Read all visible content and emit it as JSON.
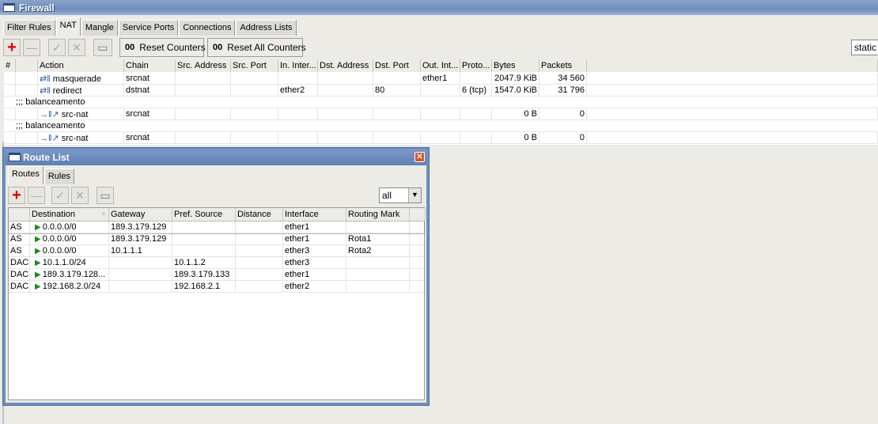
{
  "firewall": {
    "title": "Firewall",
    "tabs": [
      "Filter Rules",
      "NAT",
      "Mangle",
      "Service Ports",
      "Connections",
      "Address Lists"
    ],
    "active_tab": 1,
    "reset_counters": "Reset Counters",
    "reset_all_counters": "Reset All Counters",
    "counter_glyph": "00",
    "filter_value": "static",
    "columns": [
      "#",
      "",
      "Action",
      "Chain",
      "Src. Address",
      "Src. Port",
      "In. Inter...",
      "Dst. Address",
      "Dst. Port",
      "Out. Int...",
      "Proto...",
      "Bytes",
      "Packets"
    ],
    "rows": [
      {
        "type": "rule",
        "cells": [
          "",
          "",
          "masquerade",
          "srcnat",
          "",
          "",
          "",
          "",
          "",
          "ether1",
          "",
          "2047.9 KiB",
          "34 560"
        ]
      },
      {
        "type": "rule",
        "cells": [
          "",
          "",
          "redirect",
          "dstnat",
          "",
          "",
          "ether2",
          "",
          "80",
          "",
          "6 (tcp)",
          "1547.0 KiB",
          "31 796"
        ]
      },
      {
        "type": "comment",
        "text": ";;; balanceamento"
      },
      {
        "type": "rule",
        "cells": [
          "",
          "",
          "src-nat",
          "srcnat",
          "",
          "",
          "",
          "",
          "",
          "",
          "",
          "0 B",
          "0"
        ]
      },
      {
        "type": "comment",
        "text": ";;; balanceamento"
      },
      {
        "type": "rule",
        "cells": [
          "",
          "",
          "src-nat",
          "srcnat",
          "",
          "",
          "",
          "",
          "",
          "",
          "",
          "0 B",
          "0"
        ]
      }
    ]
  },
  "route_list": {
    "title": "Route List",
    "tabs": [
      "Routes",
      "Rules"
    ],
    "active_tab": 0,
    "filter_value": "all",
    "columns": [
      "",
      "Destination",
      "Gateway",
      "Pref. Source",
      "Distance",
      "Interface",
      "Routing Mark",
      ""
    ],
    "rows": [
      [
        "AS",
        "0.0.0.0/0",
        "189.3.179.129",
        "",
        "",
        "ether1",
        ""
      ],
      [
        "AS",
        "0.0.0.0/0",
        "189.3.179.129",
        "",
        "",
        "ether1",
        "Rota1"
      ],
      [
        "AS",
        "0.0.0.0/0",
        "10.1.1.1",
        "",
        "",
        "ether3",
        "Rota2"
      ],
      [
        "DAC",
        "10.1.1.0/24",
        "",
        "10.1.1.2",
        "",
        "ether3",
        ""
      ],
      [
        "DAC",
        "189.3.179.128...",
        "",
        "189.3.179.133",
        "",
        "ether1",
        ""
      ],
      [
        "DAC",
        "192.168.2.0/24",
        "",
        "192.168.2.1",
        "",
        "ether2",
        ""
      ]
    ]
  }
}
